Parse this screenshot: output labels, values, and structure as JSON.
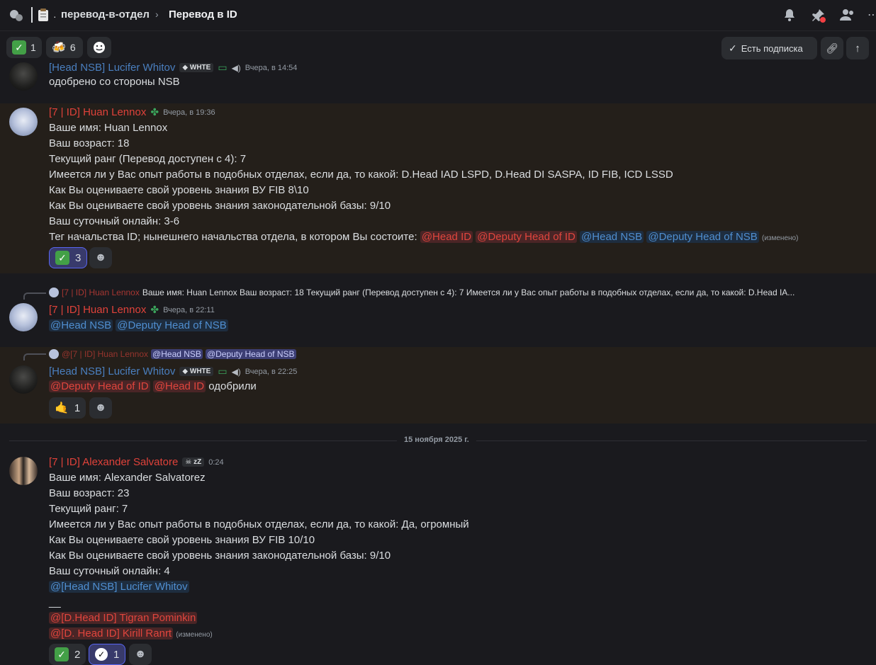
{
  "topbar": {
    "channel": "перевод-в-отдел",
    "thread": "Перевод в ID"
  },
  "pills": {
    "check_count": "1",
    "beer_count": "6",
    "subscribe_label": "Есть подписка"
  },
  "messages": {
    "m1": {
      "author": "[Head NSB] Lucifer Whitov",
      "tag": "WHTE",
      "time": "Вчера, в 14:54",
      "text": "одобрено со стороны NSB"
    },
    "m2": {
      "author": "[7 | ID] Huan Lennox",
      "time": "Вчера, в 19:36",
      "lines": [
        "Ваше имя: Huan Lennox",
        "Ваш возраст: 18",
        "Текущий ранг (Перевод доступен с 4): 7",
        "Имеется ли у Вас опыт работы в подобных отделах, если да, то какой: D.Head IAD LSPD, D.Head DI SASPA, ID FIB, ICD LSSD",
        "Как Вы оцениваете свой уровень знания ВУ FIB  8\\10",
        "Как Вы оцениваете свой уровень знания законодательной базы: 9/10",
        "Ваш суточный онлайн: 3-6"
      ],
      "tag_line_prefix": "Тег начальства ID; нынешнего начальства отдела, в котором Вы состоите: ",
      "mentions": [
        "@Head ID",
        "@Deputy Head of ID",
        "@Head NSB",
        "@Deputy Head of NSB"
      ],
      "edited": "(изменено)",
      "reaction_count": "3"
    },
    "m3": {
      "reply_author": "[7 | ID] Huan Lennox",
      "reply_text": "Ваше имя: Huan Lennox Ваш возраст: 18 Текущий ранг (Перевод доступен с 4): 7 Имеется ли у Вас опыт работы в подобных отделах, если да, то какой: D.Head IA...",
      "author": "[7 | ID] Huan Lennox",
      "time": "Вчера, в 22:11",
      "mentions": [
        "@Head NSB",
        "@Deputy Head of NSB"
      ]
    },
    "m4": {
      "reply_author": "@[7 | ID] Huan Lennox",
      "reply_mentions": [
        "@Head NSB",
        "@Deputy Head of NSB"
      ],
      "author": "[Head NSB] Lucifer Whitov",
      "tag": "WHTE",
      "time": "Вчера, в 22:25",
      "mentions": [
        "@Deputy Head of ID",
        "@Head ID"
      ],
      "text": "одобрили",
      "reaction_count": "1"
    },
    "date_divider": "15 ноября 2025 г.",
    "m5": {
      "author": "[7 | ID] Alexander Salvatore",
      "tag": "zZ",
      "time": "0:24",
      "lines": [
        "Ваше имя:  Alexander Salvatorez",
        "Ваш возраст: 23",
        "Текущий ранг: 7",
        "Имеется ли у Вас опыт работы в подобных отделах, если да, то какой: Да, огромный",
        "Как Вы оцениваете свой уровень знания ВУ FIB  10/10",
        "Как Вы оцениваете свой уровень знания законодательной базы: 9/10",
        "Ваш суточный онлайн: 4"
      ],
      "mention_blue": "@[Head NSB] Lucifer Whitov",
      "separator": "__",
      "mention_red_1": "@[D.Head ID] Tigran Pominkin",
      "mention_red_2": "@[D. Head ID]  Kirill Ranrt",
      "edited": "(изменено)",
      "reaction_check_count": "2",
      "reaction_badge_count": "1"
    }
  },
  "colors": {
    "role_red": "#e0423a",
    "role_blue": "#4a7fbf",
    "accent": "#5865f2"
  }
}
